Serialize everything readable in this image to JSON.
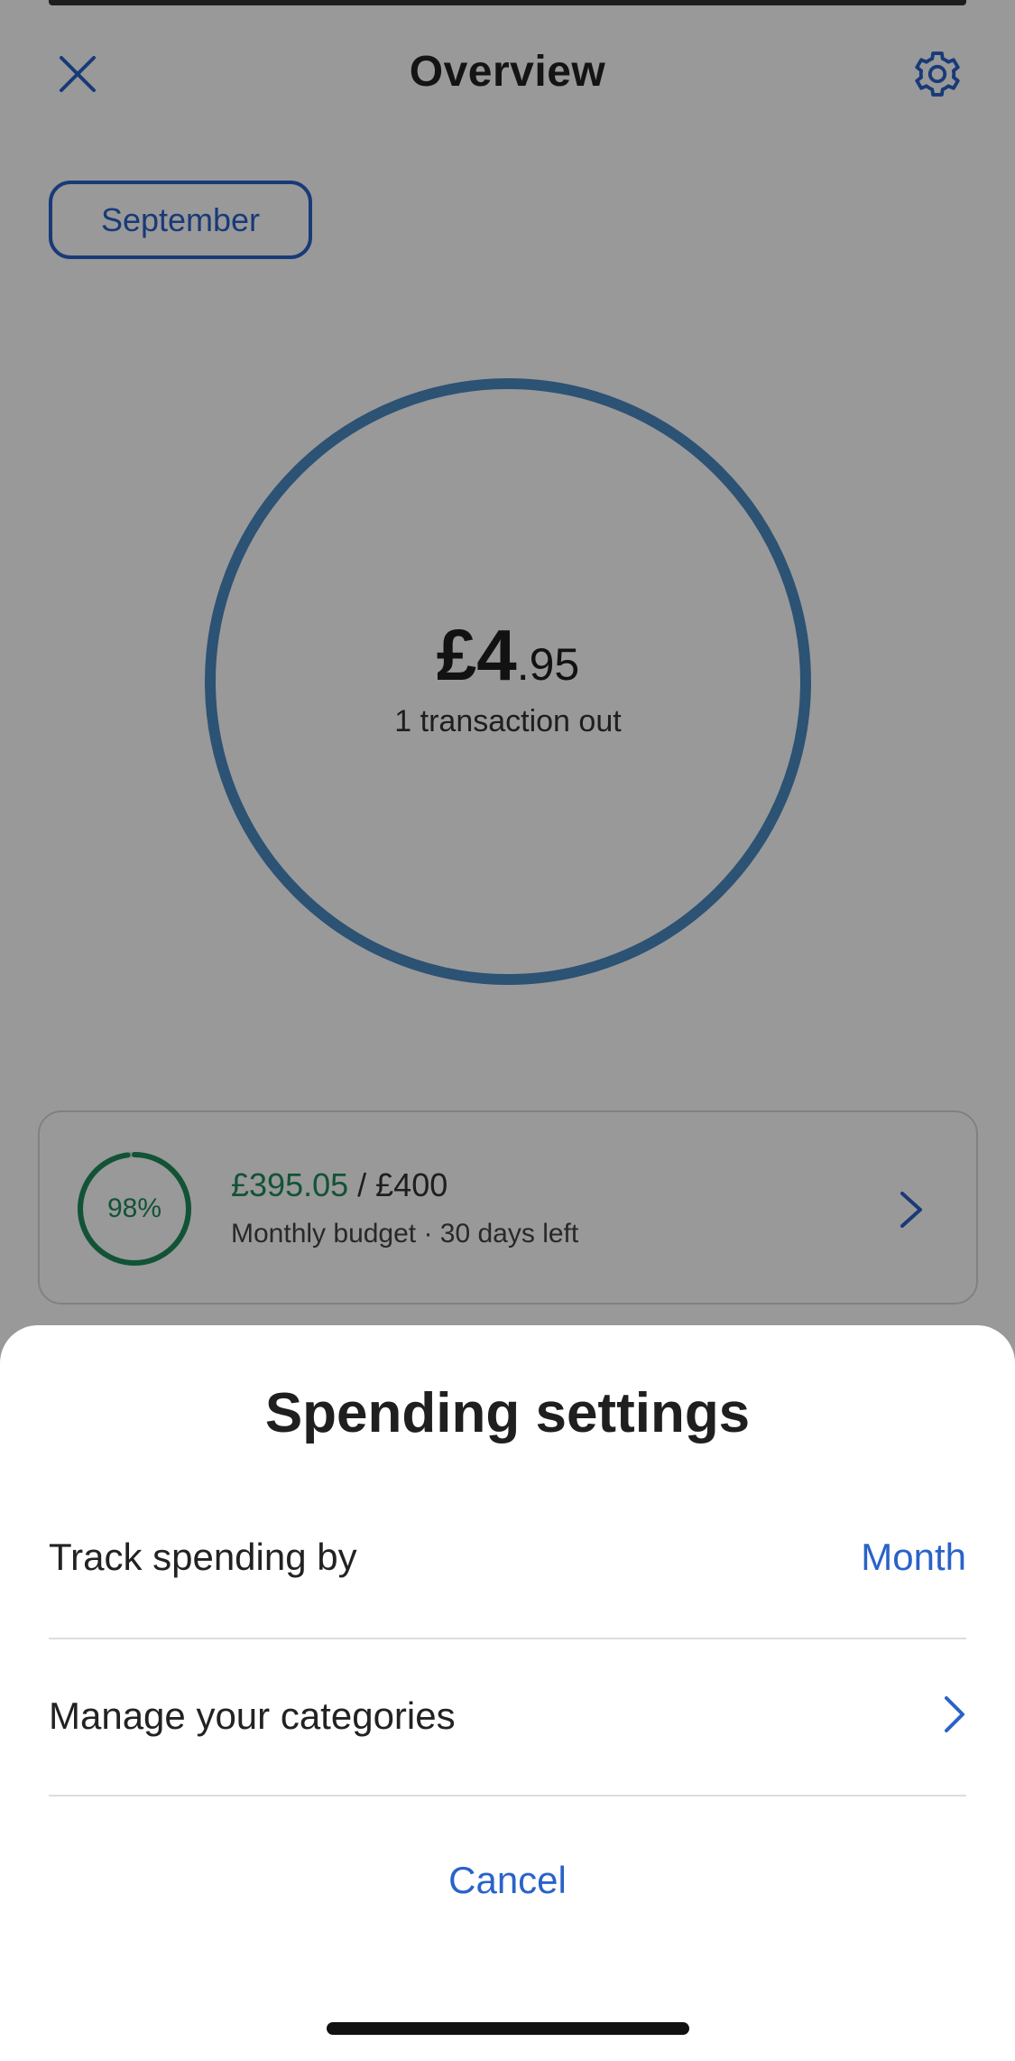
{
  "header": {
    "title": "Overview",
    "close_icon": "close-icon",
    "settings_icon": "gear-icon"
  },
  "period": {
    "label": "September"
  },
  "summary": {
    "amount_main": "£4",
    "amount_cents": ".95",
    "subtitle": "1 transaction out",
    "ring_fill_fraction": 1.0
  },
  "budget": {
    "percent_label": "98%",
    "percent_value": 0.98,
    "spent": "£395.05",
    "separator": " / ",
    "limit": "£400",
    "meta": "Monthly budget · 30 days left"
  },
  "sheet": {
    "title": "Spending settings",
    "track_label": "Track spending by",
    "track_value": "Month",
    "manage_label": "Manage your categories",
    "cancel_label": "Cancel"
  },
  "colors": {
    "accent": "#2a62c9",
    "ring_blue": "#4a89c2",
    "budget_green": "#1f8a5b",
    "overlay": "rgba(0,0,0,0.40)"
  }
}
